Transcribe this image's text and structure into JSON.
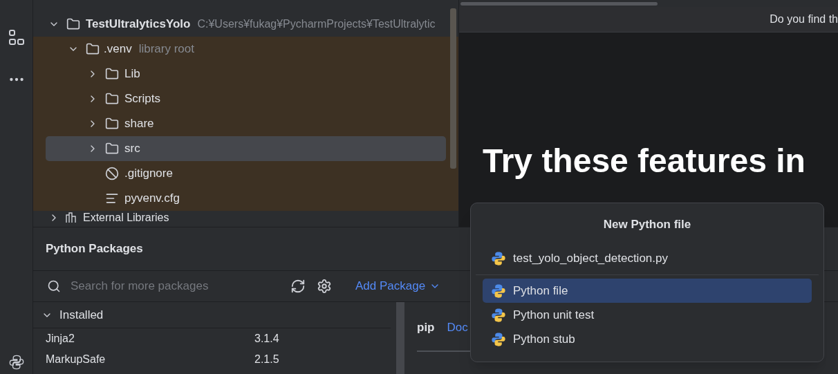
{
  "project_tree": {
    "root": {
      "name": "TestUltralyticsYolo",
      "path": "C:¥Users¥fukag¥PycharmProjects¥TestUltralytic",
      "expanded": true,
      "children": [
        {
          "name": ".venv",
          "hint": "library root",
          "kind": "folder",
          "expanded": true,
          "children": [
            {
              "name": "Lib",
              "kind": "folder",
              "expanded": false,
              "selected": false
            },
            {
              "name": "Scripts",
              "kind": "folder",
              "expanded": false,
              "selected": false
            },
            {
              "name": "share",
              "kind": "folder",
              "expanded": false,
              "selected": false
            },
            {
              "name": "src",
              "kind": "folder",
              "expanded": false,
              "selected": true
            },
            {
              "name": ".gitignore",
              "kind": "ignore",
              "selected": false
            },
            {
              "name": "pyvenv.cfg",
              "kind": "text",
              "selected": false
            }
          ]
        }
      ]
    },
    "external": {
      "name": "External Libraries",
      "expanded": false
    }
  },
  "welcome": {
    "banner": "Do you find th",
    "heading": "Try these features in"
  },
  "packages": {
    "title": "Python Packages",
    "search": {
      "placeholder": "Search for more packages"
    },
    "add_package": "Add Package",
    "section": {
      "label": "Installed",
      "expanded": true
    },
    "rows": [
      {
        "name": "Jinja2",
        "version": "3.1.4"
      },
      {
        "name": "MarkupSafe",
        "version": "2.1.5"
      }
    ],
    "detail": {
      "name": "pip",
      "link": "Doc"
    }
  },
  "popup": {
    "title": "New Python file",
    "recent": [
      {
        "label": "test_yolo_object_detection.py"
      }
    ],
    "items": [
      {
        "label": "Python file",
        "selected": true
      },
      {
        "label": "Python unit test",
        "selected": false
      },
      {
        "label": "Python stub",
        "selected": false
      }
    ]
  }
}
